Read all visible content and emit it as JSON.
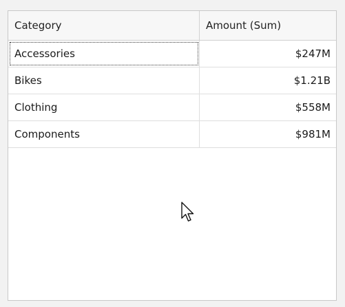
{
  "grid": {
    "columns": [
      {
        "label": "Category"
      },
      {
        "label": "Amount (Sum)"
      }
    ],
    "rows": [
      {
        "category": "Accessories",
        "amount": "$247M",
        "focused": true
      },
      {
        "category": "Bikes",
        "amount": "$1.21B",
        "focused": false
      },
      {
        "category": "Clothing",
        "amount": "$558M",
        "focused": false
      },
      {
        "category": "Components",
        "amount": "$981M",
        "focused": false
      }
    ]
  },
  "cursor": {
    "icon": "mouse-pointer-icon"
  },
  "colors": {
    "background": "#f2f2f2",
    "grid_background": "#ffffff",
    "header_background": "#f7f7f7",
    "border": "#dedede"
  }
}
